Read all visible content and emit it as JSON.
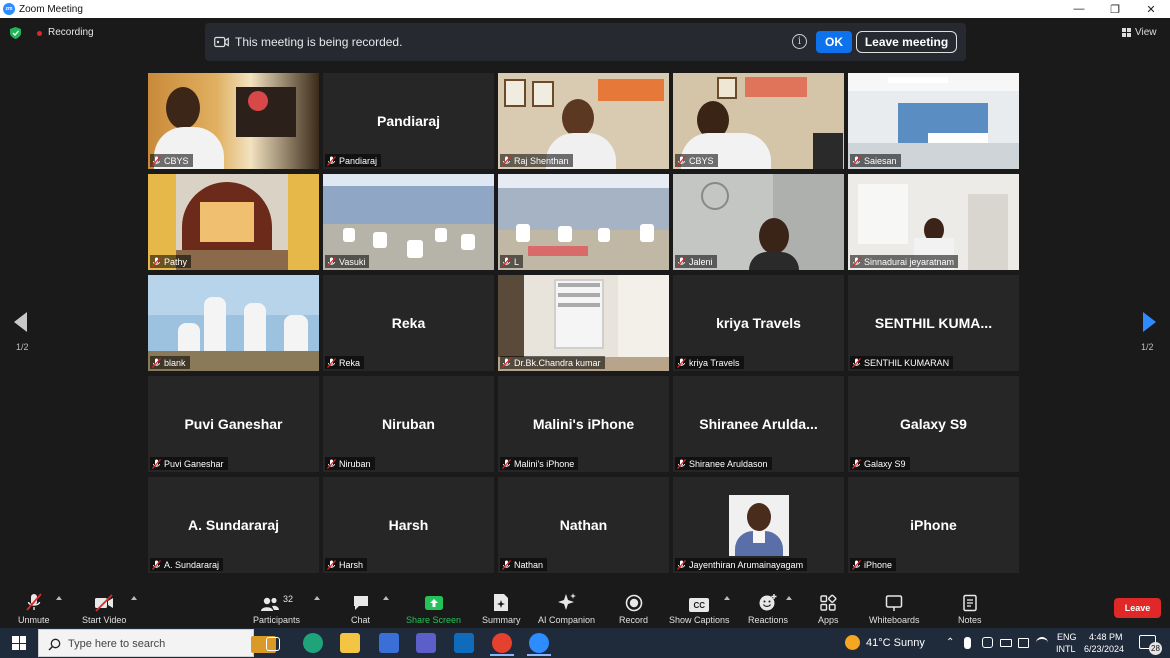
{
  "window": {
    "title": "Zoom Meeting",
    "logo_text": "zm",
    "minimize_glyph": "—",
    "restore_glyph": "❐",
    "close_glyph": "✕"
  },
  "meeting": {
    "recording_label": "Recording",
    "banner_text": "This meeting is being recorded.",
    "info_glyph": "i",
    "ok_label": "OK",
    "leave_meeting_label": "Leave meeting",
    "view_label": "View",
    "page_indicator_left": "1/2",
    "page_indicator_right": "1/2"
  },
  "participants": [
    {
      "label": "CBYS",
      "big": "",
      "video": "cbys-1",
      "active": true
    },
    {
      "label": "Pandiaraj",
      "big": "Pandiaraj",
      "video": ""
    },
    {
      "label": "Raj Shenthan",
      "big": "",
      "video": "office"
    },
    {
      "label": "CBYS",
      "big": "",
      "video": "cbys-2"
    },
    {
      "label": "Saiesan",
      "big": "",
      "video": "hall"
    },
    {
      "label": "Pathy",
      "big": "",
      "video": "shrine"
    },
    {
      "label": "Vasuki",
      "big": "",
      "video": "yoga"
    },
    {
      "label": "L",
      "big": "",
      "video": "yoga-2"
    },
    {
      "label": "Jaleni",
      "big": "",
      "video": "face"
    },
    {
      "label": "Sinnadurai jeyaratnam",
      "big": "",
      "video": "home"
    },
    {
      "label": "blank",
      "big": "",
      "video": "group"
    },
    {
      "label": "Reka",
      "big": "Reka",
      "video": ""
    },
    {
      "label": "Dr.Bk.Chandra kumar",
      "big": "",
      "video": "window"
    },
    {
      "label": "kriya Travels",
      "big": "kriya Travels",
      "video": ""
    },
    {
      "label": "SENTHIL KUMARAN",
      "big": "SENTHIL  KUMA...",
      "video": ""
    },
    {
      "label": "Puvi Ganeshar",
      "big": "Puvi Ganeshar",
      "video": ""
    },
    {
      "label": "Niruban",
      "big": "Niruban",
      "video": ""
    },
    {
      "label": "Malini's iPhone",
      "big": "Malini's iPhone",
      "video": ""
    },
    {
      "label": "Shiranee Aruldason",
      "big": "Shiranee  Arulda...",
      "video": ""
    },
    {
      "label": "Galaxy S9",
      "big": "Galaxy S9",
      "video": ""
    },
    {
      "label": "A. Sundararaj",
      "big": "A. Sundararaj",
      "video": ""
    },
    {
      "label": "Harsh",
      "big": "Harsh",
      "video": ""
    },
    {
      "label": "Nathan",
      "big": "Nathan",
      "video": ""
    },
    {
      "label": "Jayenthiran Arumainayagam",
      "big": "",
      "video": "photo"
    },
    {
      "label": "iPhone",
      "big": "iPhone",
      "video": ""
    }
  ],
  "toolbar": {
    "unmute": "Unmute",
    "start_video": "Start Video",
    "participants": "Participants",
    "participants_count": "32",
    "chat": "Chat",
    "share_screen": "Share Screen",
    "summary": "Summary",
    "ai_companion": "AI Companion",
    "record": "Record",
    "show_captions": "Show Captions",
    "captions_glyph": "CC",
    "reactions": "Reactions",
    "apps": "Apps",
    "whiteboards": "Whiteboards",
    "notes": "Notes",
    "leave": "Leave"
  },
  "taskbar": {
    "search_placeholder": "Type here to search",
    "weather": "41°C  Sunny",
    "language_top": "ENG",
    "language_bottom": "INTL",
    "time": "4:48 PM",
    "date": "6/23/2024",
    "notification_count": "28"
  },
  "colors": {
    "accent": "#0e72ed",
    "leave_red": "#e02828",
    "share_green": "#25c25a",
    "active_speaker": "#f5e663"
  }
}
